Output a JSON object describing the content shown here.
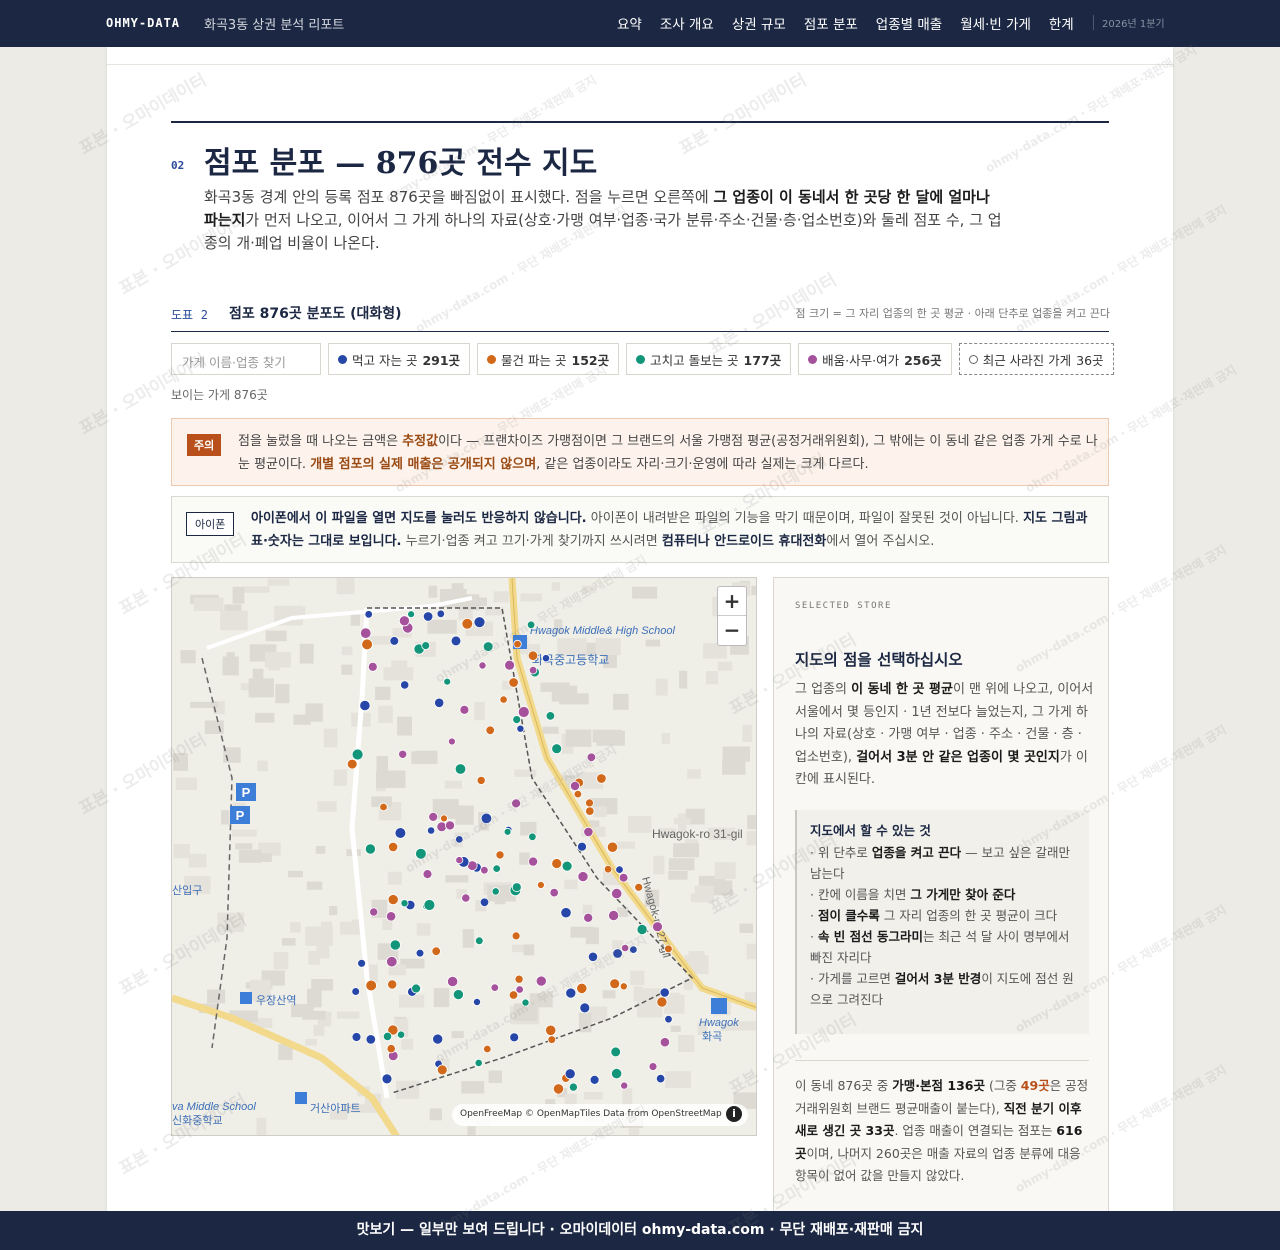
{
  "header": {
    "logo": "OHMY-DATA",
    "subtitle": "화곡3동 상권 분석 리포트",
    "nav": [
      "요약",
      "조사 개요",
      "상권 규모",
      "점포 분포",
      "업종별 매출",
      "월세·빈 가게",
      "한계"
    ],
    "date": "2026년 1분기"
  },
  "section": {
    "number": "02",
    "title": "점포 분포 — 876곳 전수 지도",
    "intro_1": "화곡3동 경계 안의 등록 점포 876곳을 빠짐없이 표시했다. 점을 누르면 오른쪽에 ",
    "intro_b1": "그 업종이 이 동네서 한 곳당 한 달에 얼마나 파는지",
    "intro_2": "가 먼저 나오고, 이어서 그 가게 하나의 자료(상호·가맹 여부·업종·국가 분류·주소·건물·층·업소번호)와 둘레 점포 수, 그 업종의 개·폐업 비율이 나온다."
  },
  "figure": {
    "label_prefix": "도표",
    "label_num": "2",
    "title": "점포 876곳 분포도 (대화형)",
    "note": "점 크기 = 그 자리 업종의 한 곳 평균 · 아래 단추로 업종을 켜고 끈다"
  },
  "filters": {
    "search_placeholder": "가게 이름·업종 찾기",
    "chips": [
      {
        "label": "먹고 자는 곳",
        "count": "291곳",
        "color": "#2747a8"
      },
      {
        "label": "물건 파는 곳",
        "count": "152곳",
        "color": "#d2681a"
      },
      {
        "label": "고치고 돌보는 곳",
        "count": "177곳",
        "color": "#13957a"
      },
      {
        "label": "배움·사무·여가",
        "count": "256곳",
        "color": "#a5519b"
      },
      {
        "label": "최근 사라진 가게",
        "count": "36곳",
        "color": "#666666"
      }
    ],
    "visible": "보이는 가게 876곳"
  },
  "warning": {
    "badge": "주의",
    "t1": "점을 눌렀을 때 나오는 금액은 ",
    "b1": "추정값",
    "t2": "이다 — 프랜차이즈 가맹점이면 그 브랜드의 서울 가맹점 평균(공정거래위원회), 그 밖에는 이 동네 같은 업종 가게 수로 나눈 평균이다. ",
    "b2": "개별 점포의 실제 매출은 공개되지 않으며",
    "t3": ", 같은 업종이라도 자리·크기·운영에 따라 실제는 크게 다르다."
  },
  "ios": {
    "badge": "아이폰",
    "b1": "아이폰에서 이 파일을 열면 지도를 눌러도 반응하지 않습니다.",
    "t1": " 아이폰이 내려받은 파일의 기능을 막기 때문이며, 파일이 잘못된 것이 아닙니다. ",
    "b2": "지도 그림과 표·숫자는 그대로 보입니다.",
    "t2": " 누르기·업종 켜고 끄기·가게 찾기까지 쓰시려면 ",
    "b3": "컴퓨터나 안드로이드 휴대전화",
    "t3": "에서 열어 주십시오."
  },
  "map": {
    "zoom_in": "+",
    "zoom_out": "−",
    "attribution": "OpenFreeMap © OpenMapTiles Data from OpenStreetMap",
    "info": "i",
    "labels": {
      "school": "Hwagok Middle& High School",
      "school_ko": "화곡중고등학교",
      "road1": "Hwagok-ro 31-gil",
      "road2": "Hwagok-ro 27-gil",
      "station": "Hwagok",
      "station_ko": "화곡",
      "bottom_school": "va Middle School",
      "bottom_school_ko": "신화중학교",
      "apt": "거산아파트",
      "bus": "우장산역",
      "entrance": "산입구"
    }
  },
  "sidebar": {
    "eyebrow": "SELECTED STORE",
    "title": "지도의 점을 선택하십시오",
    "d1": "그 업종의 ",
    "db1": "이 동네 한 곳 평균",
    "d2": "이 맨 위에 나오고, 이어서 서울에서 몇 등인지 · 1년 전보다 늘었는지, 그 가게 하나의 자료(상호 · 가맹 여부 · 업종 · 주소 · 건물 · 층 · 업소번호), ",
    "db2": "걸어서 3분 안 같은 업종이 몇 곳인지",
    "d3": "가 이 칸에 표시된다.",
    "howto_title": "지도에서 할 수 있는 것",
    "howto": [
      {
        "pre": "· 위 단추로 ",
        "b": "업종을 켜고 끈다",
        "post": " — 보고 싶은 갈래만 남는다"
      },
      {
        "pre": "· 칸에 이름을 치면 ",
        "b": "그 가게만 찾아 준다",
        "post": ""
      },
      {
        "pre": "· ",
        "b": "점이 클수록",
        "post": " 그 자리 업종의 한 곳 평균이 크다"
      },
      {
        "pre": "· ",
        "b": "속 빈 점선 동그라미",
        "post": "는 최근 석 달 사이 명부에서 빠진 자리다"
      },
      {
        "pre": "· 가게를 고르면 ",
        "b": "걸어서 3분 반경",
        "post": "이 지도에 점선 원으로 그려진다"
      }
    ],
    "s1": "이 동네 876곳 중 ",
    "sb1": "가맹·본점 136곳",
    "s2": " (그중 ",
    "sh1": "49곳",
    "s3": "은 공정거래위원회 브랜드 평균매출이 붙는다), ",
    "sb2": "직전 분기 이후 새로 생긴 곳 33곳",
    "s4": ". 업종 매출이 연결되는 점포는 ",
    "sb3": "616곳",
    "s5": "이며, 나머지 260곳은 매출 자료의 업종 분류에 대응 항목이 없어 값을 만들지 않았다."
  },
  "footer": {
    "text": "맛보기 — 일부만 보여 드립니다 · 오마이데이터 ohmy-data.com · 무단 재배포·재판매 금지"
  },
  "watermark": {
    "a": "표본 · 오마이데이터",
    "b": "ohmy-data.com · 무단 재배포·재판매 금지"
  }
}
